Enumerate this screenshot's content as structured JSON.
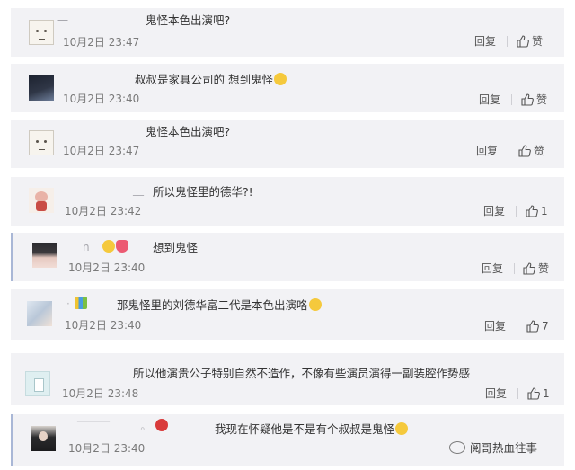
{
  "comments": [
    {
      "user": "一",
      "text": "鬼怪本色出演吧?",
      "time": "10月2日 23:47",
      "reply": "回复",
      "like": "赞"
    },
    {
      "user": "",
      "text": "叔叔是家具公司的 想到鬼怪",
      "time": "10月2日 23:40",
      "reply": "回复",
      "like": "赞"
    },
    {
      "user": "",
      "text": "鬼怪本色出演吧?",
      "time": "10月2日 23:47",
      "reply": "回复",
      "like": "赞"
    },
    {
      "user": "__",
      "text": "所以鬼怪里的德华?!",
      "time": "10月2日 23:42",
      "reply": "回复",
      "like": "1"
    },
    {
      "user": "n",
      "text": "想到鬼怪",
      "time": "10月2日 23:40",
      "reply": "回复",
      "like": "赞"
    },
    {
      "user": "",
      "text": "那鬼怪里的刘德华富二代是本色出演咯",
      "time": "10月2日 23:40",
      "reply": "回复",
      "like": "7"
    },
    {
      "user": "",
      "text": "所以他演贵公子特别自然不造作，不像有些演员演得一副装腔作势感",
      "time": "10月2日 23:48",
      "reply": "回复",
      "like": "1"
    },
    {
      "user": "",
      "text": "我现在怀疑他是不是有个叔叔是鬼怪",
      "time": "10月2日 23:40",
      "reply": "",
      "like": ""
    }
  ],
  "watermark": "阅哥热血往事",
  "icons": {
    "like": "thumbs-up-icon",
    "watermark": "wechat-icon"
  }
}
